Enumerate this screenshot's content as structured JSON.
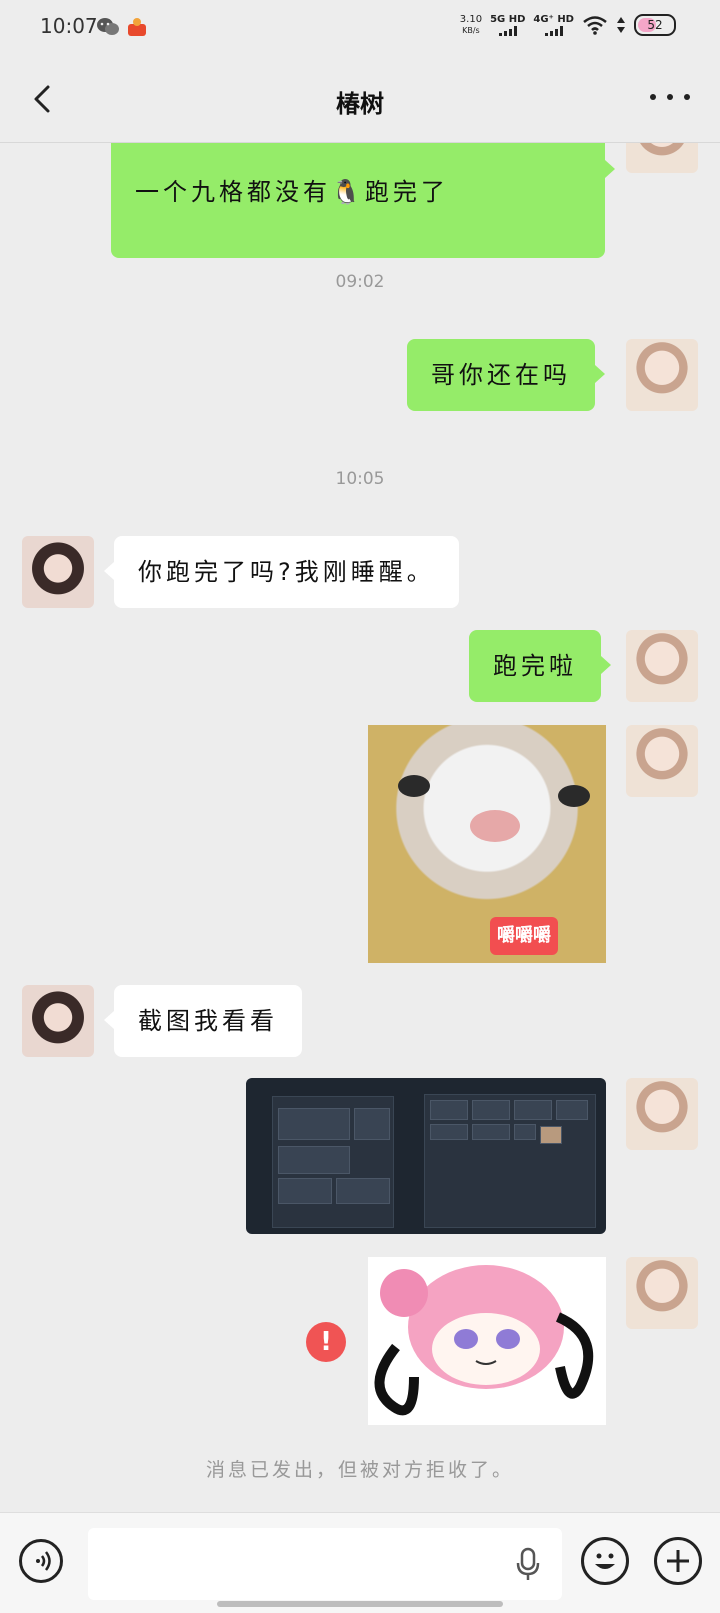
{
  "status_bar": {
    "time": "10:07",
    "net_speed_value": "3.10",
    "net_speed_unit": "KB/s",
    "sim1_label": "5G HD",
    "sim2_label": "4G⁺ HD",
    "battery_level": "52",
    "icons": [
      "wechat-icon",
      "app-notification-icon",
      "signal-icon",
      "wifi-icon",
      "battery-icon"
    ]
  },
  "header": {
    "title": "椿树",
    "back_icon": "chevron-left-icon",
    "more_icon": "more-icon"
  },
  "messages": [
    {
      "type": "text",
      "direction": "out",
      "text": "一个九格都没有🐧跑完了",
      "partial_top": true
    },
    {
      "type": "timestamp",
      "text": "09:02"
    },
    {
      "type": "text",
      "direction": "out",
      "text": "哥你还在吗"
    },
    {
      "type": "timestamp",
      "text": "10:05"
    },
    {
      "type": "text",
      "direction": "in",
      "text": "你跑完了吗?我刚睡醒。"
    },
    {
      "type": "text",
      "direction": "out",
      "text": "跑完啦"
    },
    {
      "type": "sticker",
      "direction": "out",
      "subject": "cat-face",
      "badge_text": "嚼嚼嚼"
    },
    {
      "type": "text",
      "direction": "in",
      "text": "截图我看看"
    },
    {
      "type": "image",
      "direction": "out",
      "subject": "game-inventory-screenshot"
    },
    {
      "type": "sticker",
      "direction": "out",
      "subject": "pink-hair-anime-girl",
      "status": "failed"
    }
  ],
  "system_note": "消息已发出，但被对方拒收了。",
  "input_bar": {
    "placeholder": "",
    "value": "",
    "icons": [
      "voice-icon",
      "microphone-icon",
      "emoji-icon",
      "plus-icon"
    ]
  },
  "colors": {
    "outgoing_bubble": "#95ec69",
    "incoming_bubble": "#ffffff",
    "background": "#ededed",
    "error": "#f05454"
  }
}
